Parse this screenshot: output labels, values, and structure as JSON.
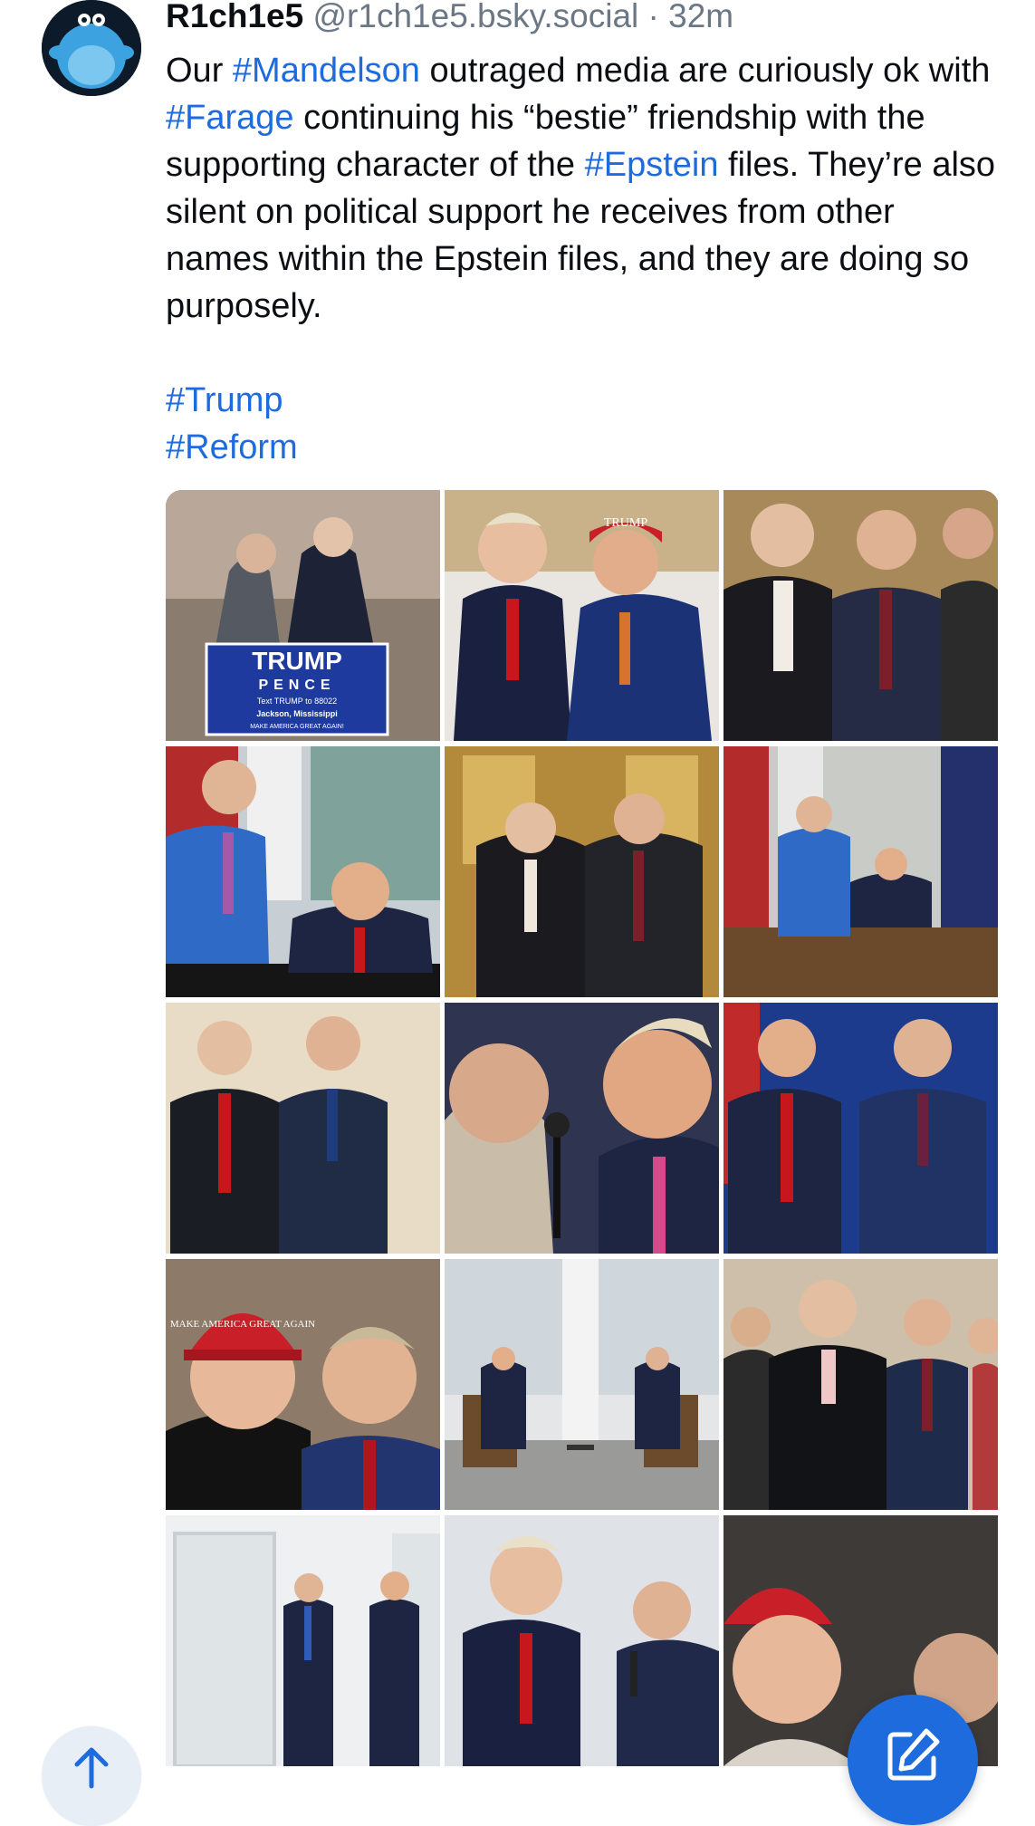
{
  "author": {
    "display_name": "R1ch1e5",
    "handle": "@r1ch1e5.bsky.social",
    "separator": "·",
    "time": "32m",
    "avatar_icon": "blue-creature-avatar"
  },
  "post": {
    "segments": [
      {
        "text": "Our ",
        "tag": false
      },
      {
        "text": "#Mandelson",
        "tag": true
      },
      {
        "text": " outraged media are curiously ok with ",
        "tag": false
      },
      {
        "text": "#Farage",
        "tag": true
      },
      {
        "text": " continuing his “bestie” friendship with the supporting character of the ",
        "tag": false
      },
      {
        "text": "#Epstein",
        "tag": true
      },
      {
        "text": " files. They’re also silent on political support he receives from other names within the Epstein files, and they are doing so purposely.",
        "tag": false
      }
    ],
    "hashtags": [
      "#Trump",
      "#Reform"
    ]
  },
  "images": {
    "count": 15,
    "columns": 3,
    "sign_text": {
      "line1": "TRUMP",
      "line2": "PENCE",
      "line3": "Text TRUMP to 88022",
      "line4": "Jackson, Mississippi",
      "line5": "MAKE AMERICA GREAT AGAIN!"
    },
    "hat_text_1": "TRUMP",
    "hat_text_2": "MAKE AMERICA GREAT AGAIN"
  },
  "fab": {
    "scroll_top_icon": "arrow-up-icon",
    "compose_icon": "compose-icon"
  },
  "colors": {
    "link": "#1d6bdc",
    "text": "#0b0f14",
    "muted": "#6b7785",
    "fab": "#1d6bdc"
  }
}
